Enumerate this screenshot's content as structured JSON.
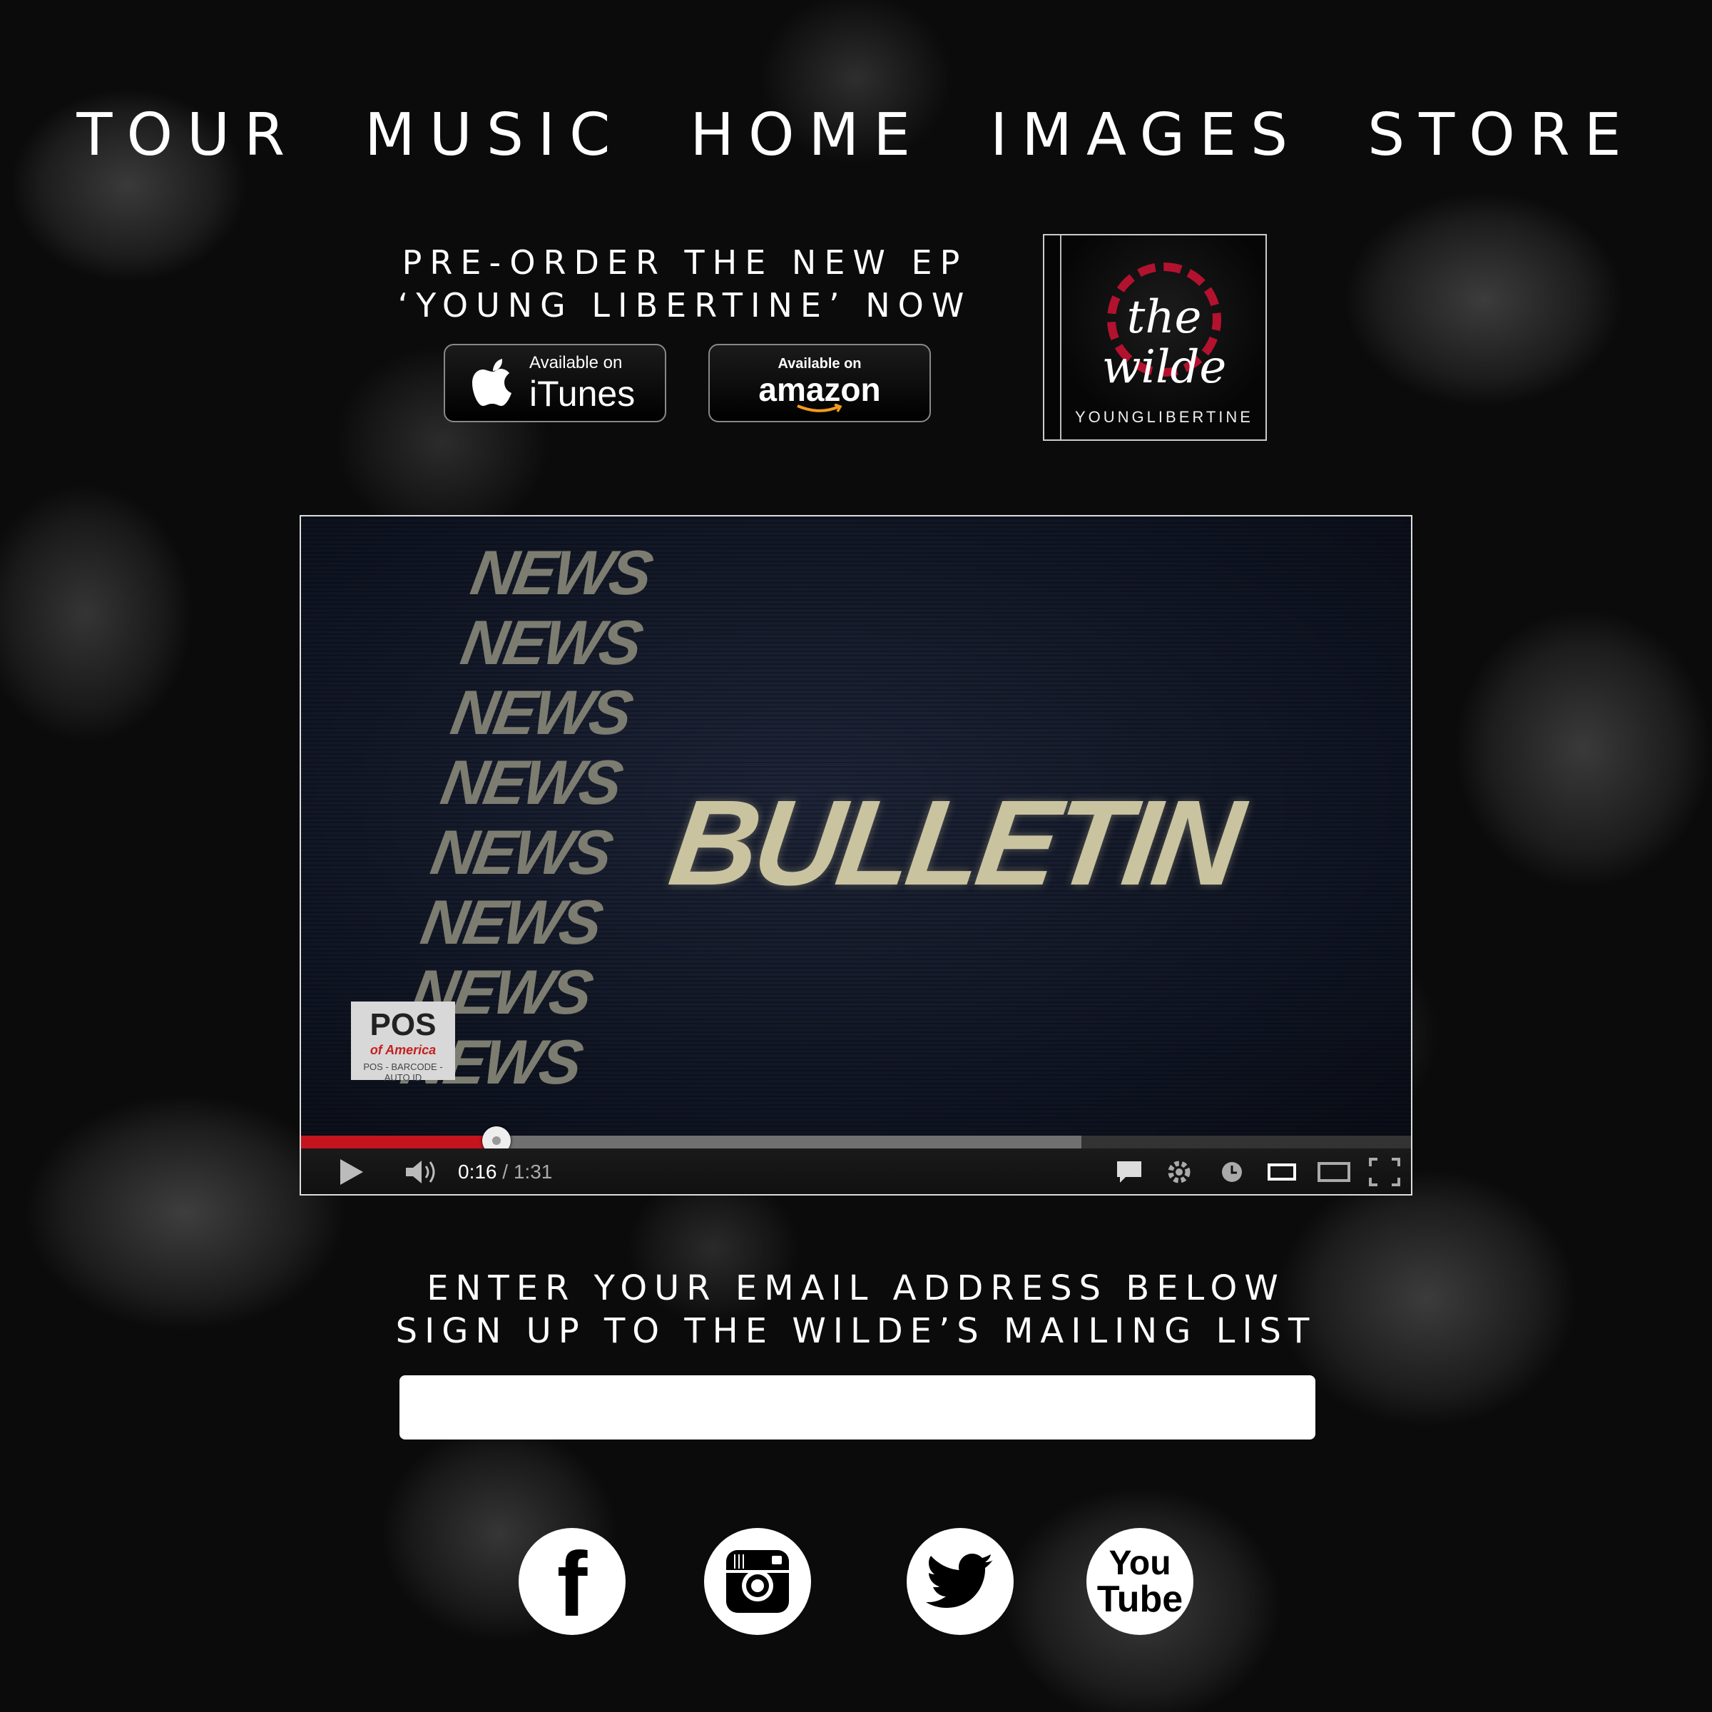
{
  "nav": {
    "items": [
      "TOUR",
      "MUSIC",
      "HOME",
      "IMAGES",
      "STORE"
    ]
  },
  "preorder": {
    "line1": "PRE-ORDER THE NEW EP",
    "line2": "‘YOUNG LIBERTINE’ NOW"
  },
  "itunes_button": {
    "small": "Available on",
    "big": "iTunes",
    "icon": "apple-icon"
  },
  "amazon_button": {
    "small": "Available on",
    "big": "amazon",
    "icon": "amazon-smile-icon"
  },
  "album": {
    "logo_top": "the",
    "logo_bottom": "wilde",
    "caption": "YOUNGLIBERTINE",
    "accent_color": "#b3122e"
  },
  "video": {
    "news_lines": [
      "NEWS",
      "NEWS",
      "NEWS",
      "NEWS",
      "NEWS",
      "NEWS",
      "NEWS",
      "NEWS"
    ],
    "headline": "BULLETIN",
    "badge": {
      "main": "POS",
      "sub": "of America",
      "tag": "POS - BARCODE - AUTO ID"
    },
    "current_time": "0:16",
    "separator": " / ",
    "duration": "1:31",
    "played_fraction": 0.1758,
    "buffered_fraction": 0.7033,
    "progress_color": "#c4141e"
  },
  "mailing": {
    "line1": "ENTER YOUR EMAIL ADDRESS BELOW",
    "line2": "SIGN UP TO THE WILDE’S MAILING LIST",
    "input_value": "",
    "input_placeholder": ""
  },
  "social": {
    "facebook_glyph": "f",
    "youtube_top": "You",
    "youtube_bottom": "Tube",
    "icons": [
      "facebook-icon",
      "instagram-icon",
      "twitter-icon",
      "youtube-icon"
    ]
  }
}
